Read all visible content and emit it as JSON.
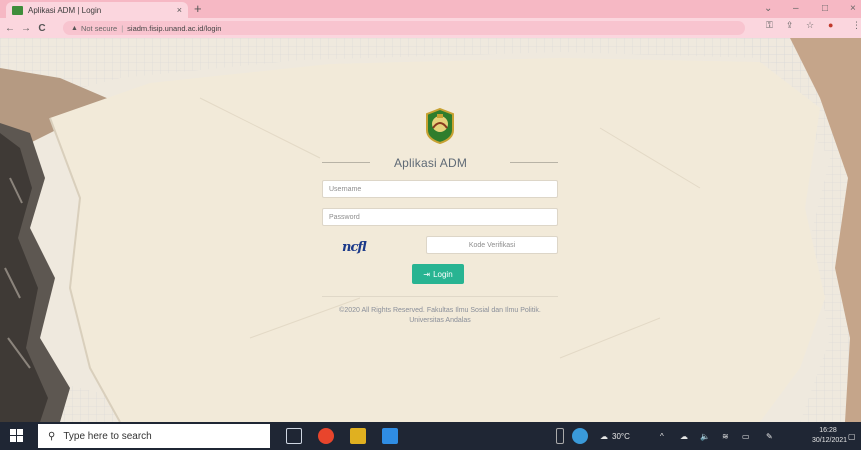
{
  "browser": {
    "tab_title": "Aplikasi ADM | Login",
    "tab_close": "×",
    "new_tab": "+",
    "window_controls": {
      "minimize": "–",
      "maximize": "□",
      "close": "×"
    },
    "nav": {
      "back": "←",
      "forward": "→",
      "reload": "C"
    },
    "security_label": "Not secure",
    "url": "siadm.fisip.unand.ac.id/login"
  },
  "login": {
    "app_title": "Aplikasi ADM",
    "username_placeholder": "Username",
    "password_placeholder": "Password",
    "captcha_text": "ncfl",
    "verification_placeholder": "Kode Verifikasi",
    "login_button": "Login",
    "footer": "©2020 All Rights Reserved. Fakultas Ilmu Sosial dan Ilmu Politik. Universitas Andalas"
  },
  "taskbar": {
    "search_placeholder": "Type here to search",
    "temperature": "30°C",
    "time": "16:28",
    "date": "30/12/2021"
  },
  "colors": {
    "tab_strip": "#f6b8c4",
    "page_bg": "#ebe1cd",
    "login_button": "#28b492",
    "taskbar": "#1f2634"
  }
}
